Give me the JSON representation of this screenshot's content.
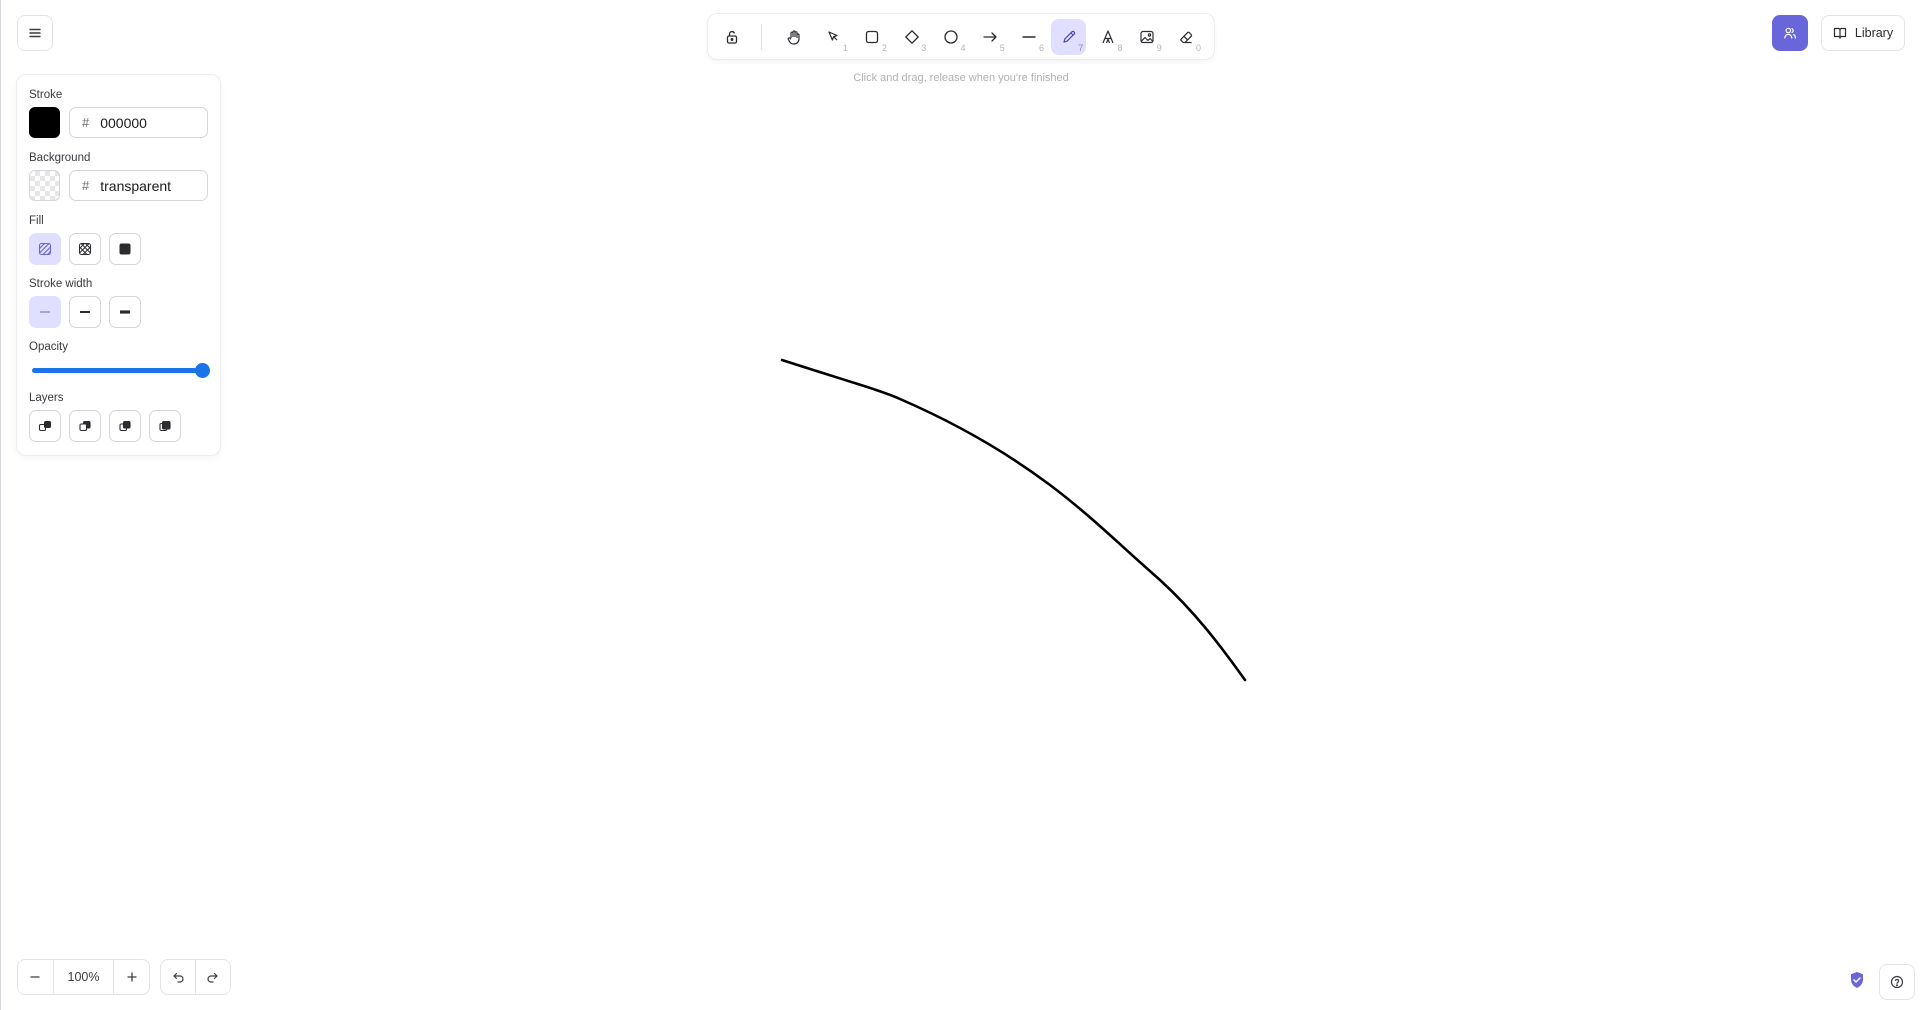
{
  "toolbar": {
    "tools": [
      {
        "name": "lock",
        "key": ""
      },
      {
        "name": "hand",
        "key": ""
      },
      {
        "name": "selection",
        "key": "1"
      },
      {
        "name": "rectangle",
        "key": "2"
      },
      {
        "name": "diamond",
        "key": "3"
      },
      {
        "name": "ellipse",
        "key": "4"
      },
      {
        "name": "arrow",
        "key": "5"
      },
      {
        "name": "line",
        "key": "6"
      },
      {
        "name": "draw",
        "key": "7"
      },
      {
        "name": "text",
        "key": "8"
      },
      {
        "name": "image",
        "key": "9"
      },
      {
        "name": "eraser",
        "key": "0"
      }
    ],
    "active_tool": "draw",
    "hint": "Click and drag, release when you're finished"
  },
  "panel": {
    "stroke_label": "Stroke",
    "stroke_color": "#000000",
    "stroke_hex": "000000",
    "background_label": "Background",
    "background_hex": "transparent",
    "hash": "#",
    "fill_label": "Fill",
    "fill_options": [
      "hachure",
      "cross-hatch",
      "solid"
    ],
    "fill_selected": "hachure",
    "stroke_width_label": "Stroke width",
    "stroke_width_options": [
      "thin",
      "bold",
      "extra-bold"
    ],
    "stroke_width_selected": "thin",
    "opacity_label": "Opacity",
    "opacity_value": 100,
    "layers_label": "Layers",
    "layers_buttons": [
      "send-to-back",
      "send-backward",
      "bring-forward",
      "bring-to-front"
    ]
  },
  "footer": {
    "zoom_value": "100%"
  },
  "header": {
    "library_label": "Library"
  },
  "colors": {
    "accent": "#6965db",
    "active_bg": "#e0dfff",
    "slider": "#1a73e8"
  }
}
